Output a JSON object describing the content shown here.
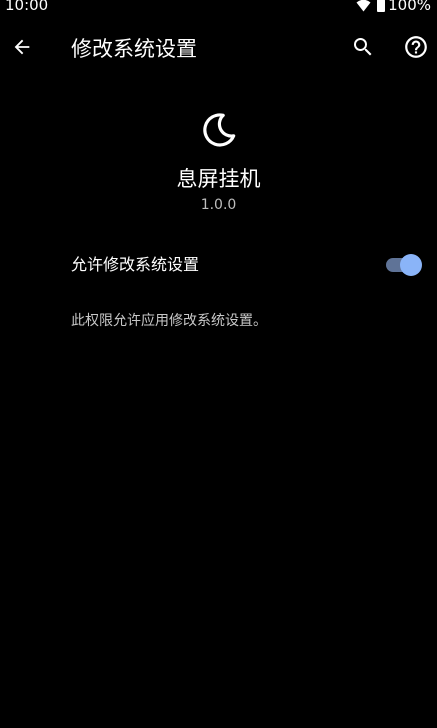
{
  "status_bar": {
    "time": "10:00",
    "battery": "100%",
    "icons": [
      "wifi-icon",
      "battery-icon"
    ]
  },
  "app_bar": {
    "title": "修改系统设置",
    "back_icon": "arrow-back-icon",
    "search_icon": "search-icon",
    "help_icon": "help-icon"
  },
  "app_info": {
    "icon": "moon-icon",
    "name": "息屏挂机",
    "version": "1.0.0"
  },
  "setting": {
    "label": "允许修改系统设置",
    "enabled": true,
    "description": "此权限允许应用修改系统设置。"
  },
  "colors": {
    "background": "#000000",
    "accent": "#8ab4f8",
    "toggle_track": "#5f7397",
    "text_primary": "#ffffff",
    "text_secondary": "#c8c8c8"
  }
}
